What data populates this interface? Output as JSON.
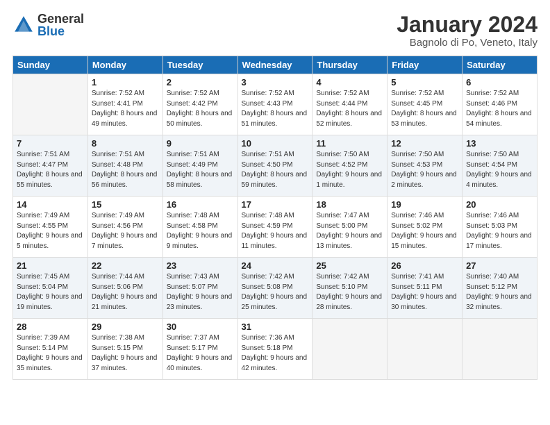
{
  "header": {
    "logo_general": "General",
    "logo_blue": "Blue",
    "month_title": "January 2024",
    "location": "Bagnolo di Po, Veneto, Italy"
  },
  "days_of_week": [
    "Sunday",
    "Monday",
    "Tuesday",
    "Wednesday",
    "Thursday",
    "Friday",
    "Saturday"
  ],
  "weeks": [
    [
      {
        "day": "",
        "sunrise": "",
        "sunset": "",
        "daylight": "",
        "empty": true
      },
      {
        "day": "1",
        "sunrise": "Sunrise: 7:52 AM",
        "sunset": "Sunset: 4:41 PM",
        "daylight": "Daylight: 8 hours and 49 minutes."
      },
      {
        "day": "2",
        "sunrise": "Sunrise: 7:52 AM",
        "sunset": "Sunset: 4:42 PM",
        "daylight": "Daylight: 8 hours and 50 minutes."
      },
      {
        "day": "3",
        "sunrise": "Sunrise: 7:52 AM",
        "sunset": "Sunset: 4:43 PM",
        "daylight": "Daylight: 8 hours and 51 minutes."
      },
      {
        "day": "4",
        "sunrise": "Sunrise: 7:52 AM",
        "sunset": "Sunset: 4:44 PM",
        "daylight": "Daylight: 8 hours and 52 minutes."
      },
      {
        "day": "5",
        "sunrise": "Sunrise: 7:52 AM",
        "sunset": "Sunset: 4:45 PM",
        "daylight": "Daylight: 8 hours and 53 minutes."
      },
      {
        "day": "6",
        "sunrise": "Sunrise: 7:52 AM",
        "sunset": "Sunset: 4:46 PM",
        "daylight": "Daylight: 8 hours and 54 minutes."
      }
    ],
    [
      {
        "day": "7",
        "sunrise": "Sunrise: 7:51 AM",
        "sunset": "Sunset: 4:47 PM",
        "daylight": "Daylight: 8 hours and 55 minutes."
      },
      {
        "day": "8",
        "sunrise": "Sunrise: 7:51 AM",
        "sunset": "Sunset: 4:48 PM",
        "daylight": "Daylight: 8 hours and 56 minutes."
      },
      {
        "day": "9",
        "sunrise": "Sunrise: 7:51 AM",
        "sunset": "Sunset: 4:49 PM",
        "daylight": "Daylight: 8 hours and 58 minutes."
      },
      {
        "day": "10",
        "sunrise": "Sunrise: 7:51 AM",
        "sunset": "Sunset: 4:50 PM",
        "daylight": "Daylight: 8 hours and 59 minutes."
      },
      {
        "day": "11",
        "sunrise": "Sunrise: 7:50 AM",
        "sunset": "Sunset: 4:52 PM",
        "daylight": "Daylight: 9 hours and 1 minute."
      },
      {
        "day": "12",
        "sunrise": "Sunrise: 7:50 AM",
        "sunset": "Sunset: 4:53 PM",
        "daylight": "Daylight: 9 hours and 2 minutes."
      },
      {
        "day": "13",
        "sunrise": "Sunrise: 7:50 AM",
        "sunset": "Sunset: 4:54 PM",
        "daylight": "Daylight: 9 hours and 4 minutes."
      }
    ],
    [
      {
        "day": "14",
        "sunrise": "Sunrise: 7:49 AM",
        "sunset": "Sunset: 4:55 PM",
        "daylight": "Daylight: 9 hours and 5 minutes."
      },
      {
        "day": "15",
        "sunrise": "Sunrise: 7:49 AM",
        "sunset": "Sunset: 4:56 PM",
        "daylight": "Daylight: 9 hours and 7 minutes."
      },
      {
        "day": "16",
        "sunrise": "Sunrise: 7:48 AM",
        "sunset": "Sunset: 4:58 PM",
        "daylight": "Daylight: 9 hours and 9 minutes."
      },
      {
        "day": "17",
        "sunrise": "Sunrise: 7:48 AM",
        "sunset": "Sunset: 4:59 PM",
        "daylight": "Daylight: 9 hours and 11 minutes."
      },
      {
        "day": "18",
        "sunrise": "Sunrise: 7:47 AM",
        "sunset": "Sunset: 5:00 PM",
        "daylight": "Daylight: 9 hours and 13 minutes."
      },
      {
        "day": "19",
        "sunrise": "Sunrise: 7:46 AM",
        "sunset": "Sunset: 5:02 PM",
        "daylight": "Daylight: 9 hours and 15 minutes."
      },
      {
        "day": "20",
        "sunrise": "Sunrise: 7:46 AM",
        "sunset": "Sunset: 5:03 PM",
        "daylight": "Daylight: 9 hours and 17 minutes."
      }
    ],
    [
      {
        "day": "21",
        "sunrise": "Sunrise: 7:45 AM",
        "sunset": "Sunset: 5:04 PM",
        "daylight": "Daylight: 9 hours and 19 minutes."
      },
      {
        "day": "22",
        "sunrise": "Sunrise: 7:44 AM",
        "sunset": "Sunset: 5:06 PM",
        "daylight": "Daylight: 9 hours and 21 minutes."
      },
      {
        "day": "23",
        "sunrise": "Sunrise: 7:43 AM",
        "sunset": "Sunset: 5:07 PM",
        "daylight": "Daylight: 9 hours and 23 minutes."
      },
      {
        "day": "24",
        "sunrise": "Sunrise: 7:42 AM",
        "sunset": "Sunset: 5:08 PM",
        "daylight": "Daylight: 9 hours and 25 minutes."
      },
      {
        "day": "25",
        "sunrise": "Sunrise: 7:42 AM",
        "sunset": "Sunset: 5:10 PM",
        "daylight": "Daylight: 9 hours and 28 minutes."
      },
      {
        "day": "26",
        "sunrise": "Sunrise: 7:41 AM",
        "sunset": "Sunset: 5:11 PM",
        "daylight": "Daylight: 9 hours and 30 minutes."
      },
      {
        "day": "27",
        "sunrise": "Sunrise: 7:40 AM",
        "sunset": "Sunset: 5:12 PM",
        "daylight": "Daylight: 9 hours and 32 minutes."
      }
    ],
    [
      {
        "day": "28",
        "sunrise": "Sunrise: 7:39 AM",
        "sunset": "Sunset: 5:14 PM",
        "daylight": "Daylight: 9 hours and 35 minutes."
      },
      {
        "day": "29",
        "sunrise": "Sunrise: 7:38 AM",
        "sunset": "Sunset: 5:15 PM",
        "daylight": "Daylight: 9 hours and 37 minutes."
      },
      {
        "day": "30",
        "sunrise": "Sunrise: 7:37 AM",
        "sunset": "Sunset: 5:17 PM",
        "daylight": "Daylight: 9 hours and 40 minutes."
      },
      {
        "day": "31",
        "sunrise": "Sunrise: 7:36 AM",
        "sunset": "Sunset: 5:18 PM",
        "daylight": "Daylight: 9 hours and 42 minutes."
      },
      {
        "day": "",
        "sunrise": "",
        "sunset": "",
        "daylight": "",
        "empty": true
      },
      {
        "day": "",
        "sunrise": "",
        "sunset": "",
        "daylight": "",
        "empty": true
      },
      {
        "day": "",
        "sunrise": "",
        "sunset": "",
        "daylight": "",
        "empty": true
      }
    ]
  ]
}
